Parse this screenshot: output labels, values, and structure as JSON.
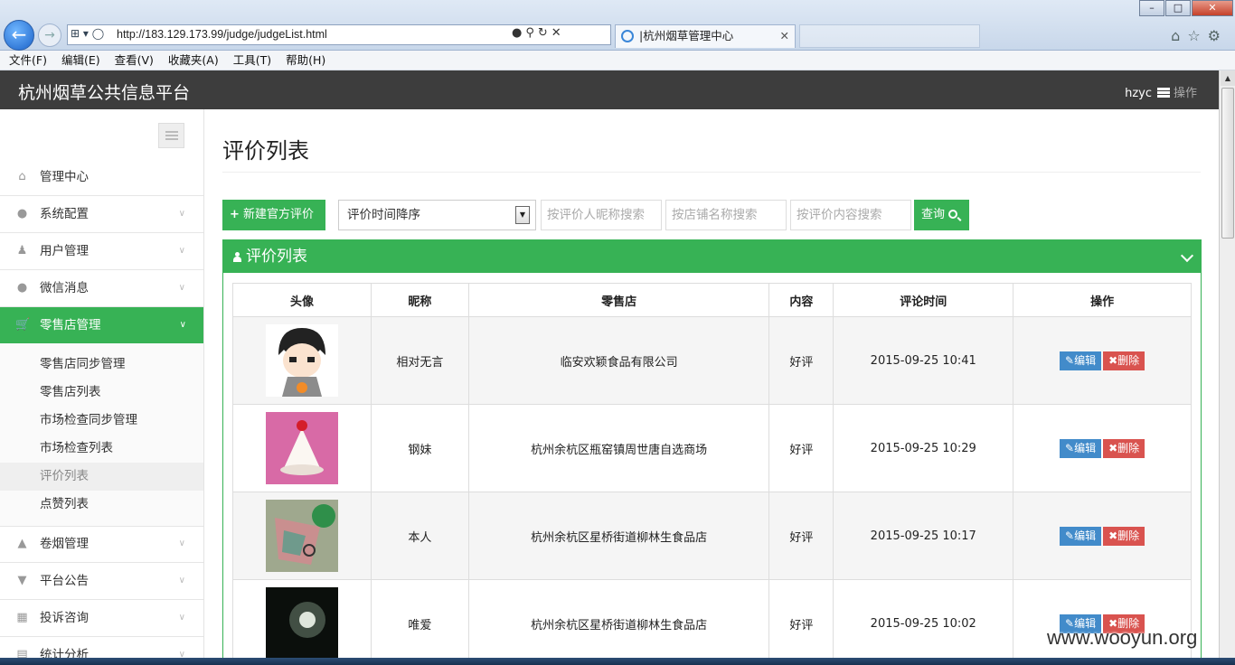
{
  "browser": {
    "url": "http://183.129.173.99/judge/judgeList.html",
    "tab_title": "|杭州烟草管理中心",
    "menu": [
      "文件(F)",
      "编辑(E)",
      "查看(V)",
      "收藏夹(A)",
      "工具(T)",
      "帮助(H)"
    ]
  },
  "header": {
    "title": "杭州烟草公共信息平台",
    "username": "hzyc",
    "op_label": "操作"
  },
  "sidebar": {
    "items": [
      {
        "label": "管理中心",
        "icon": "home-icon"
      },
      {
        "label": "系统配置",
        "icon": "chat-icon"
      },
      {
        "label": "用户管理",
        "icon": "users-icon"
      },
      {
        "label": "微信消息",
        "icon": "chat-icon"
      },
      {
        "label": "零售店管理",
        "icon": "cart-icon"
      },
      {
        "label": "卷烟管理",
        "icon": "fire-icon"
      },
      {
        "label": "平台公告",
        "icon": "bullhorn-icon"
      },
      {
        "label": "投诉咨询",
        "icon": "qrcode-icon"
      },
      {
        "label": "统计分析",
        "icon": "chart-icon"
      }
    ],
    "sub_items": [
      "零售店同步管理",
      "零售店列表",
      "市场检查同步管理",
      "市场检查列表",
      "评价列表",
      "点赞列表"
    ]
  },
  "main": {
    "page_title": "评价列表",
    "new_button": "新建官方评价",
    "sort_selected": "评价时间降序",
    "search_nickname_placeholder": "按评价人昵称搜索",
    "search_store_placeholder": "按店铺名称搜索",
    "search_content_placeholder": "按评价内容搜索",
    "query_button": "查询",
    "panel_title": "评价列表",
    "table": {
      "headers": [
        "头像",
        "昵称",
        "零售店",
        "内容",
        "评论时间",
        "操作"
      ],
      "rows": [
        {
          "nickname": "相对无言",
          "store": "临安欢颖食品有限公司",
          "content": "好评",
          "time": "2015-09-25 10:41"
        },
        {
          "nickname": "钢妹",
          "store": "杭州余杭区瓶窑镇周世唐自选商场",
          "content": "好评",
          "time": "2015-09-25 10:29"
        },
        {
          "nickname": "本人",
          "store": "杭州余杭区星桥街道柳林生食品店",
          "content": "好评",
          "time": "2015-09-25 10:17"
        },
        {
          "nickname": "唯爱",
          "store": "杭州余杭区星桥街道柳林生食品店",
          "content": "好评",
          "time": "2015-09-25 10:02"
        }
      ],
      "edit_label": "编辑",
      "delete_label": "删除"
    }
  },
  "watermark": "www.wooyun.org",
  "colors": {
    "accent": "#37b255",
    "header_bg": "#3d3d3d",
    "edit": "#428bca",
    "delete": "#d9534f"
  }
}
